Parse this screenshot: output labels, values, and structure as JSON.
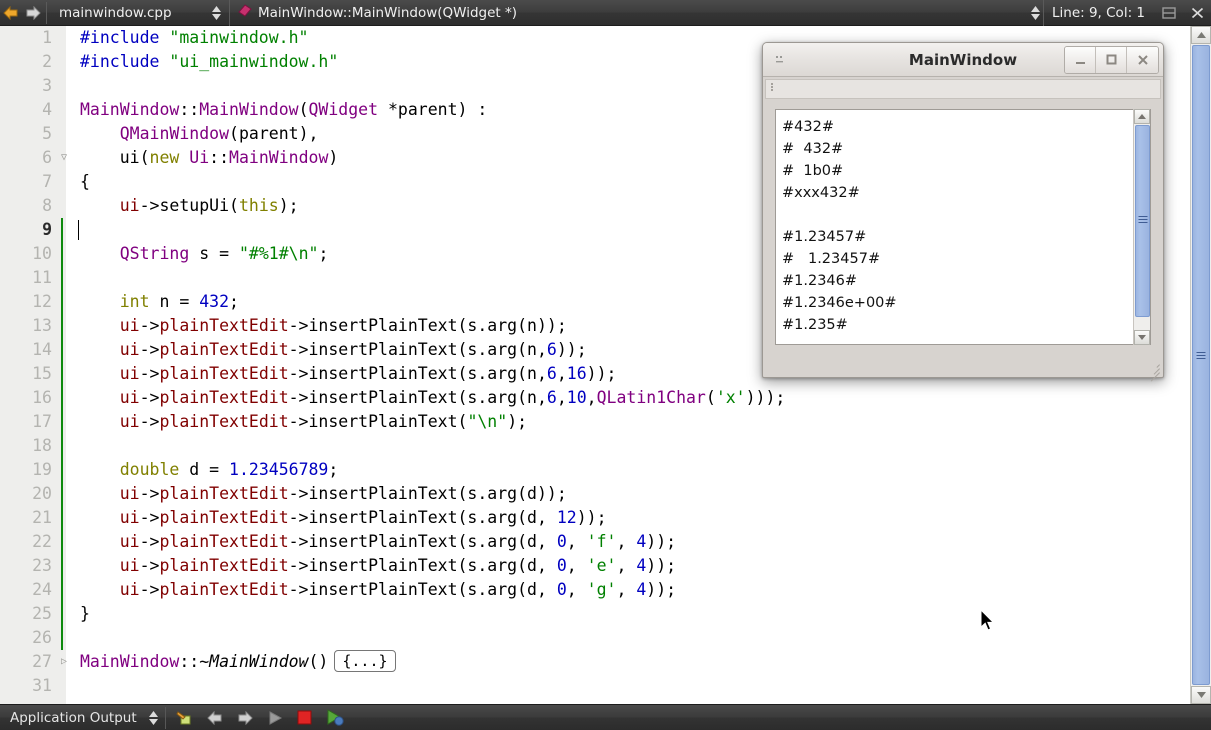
{
  "toolbar": {
    "back_icon": "back-arrow-icon",
    "forward_icon": "forward-arrow-icon",
    "file_name": "mainwindow.cpp",
    "symbol_name": "MainWindow::MainWindow(QWidget *)",
    "symbol_icon": "class-symbol-icon",
    "line_col": "Line: 9, Col: 1",
    "split_icon": "split-editor-icon",
    "close_icon": "close-editor-icon",
    "accent": "#e8a33d"
  },
  "editor": {
    "current_line": 9,
    "lines": [
      {
        "num": "1",
        "fold": "",
        "tokens": [
          {
            "t": "#include ",
            "c": "t-pre"
          },
          {
            "t": "\"mainwindow.h\"",
            "c": "t-str"
          }
        ]
      },
      {
        "num": "2",
        "fold": "",
        "tokens": [
          {
            "t": "#include ",
            "c": "t-pre"
          },
          {
            "t": "\"ui_mainwindow.h\"",
            "c": "t-str"
          }
        ]
      },
      {
        "num": "3",
        "fold": "",
        "tokens": []
      },
      {
        "num": "4",
        "fold": "",
        "tokens": [
          {
            "t": "MainWindow",
            "c": "t-type"
          },
          {
            "t": "::",
            "c": "t-op"
          },
          {
            "t": "MainWindow",
            "c": "t-type"
          },
          {
            "t": "(",
            "c": "t-op"
          },
          {
            "t": "QWidget",
            "c": "t-type"
          },
          {
            "t": " *parent) :",
            "c": "t-op"
          }
        ]
      },
      {
        "num": "5",
        "fold": "",
        "tokens": [
          {
            "t": "    ",
            "c": "t-op"
          },
          {
            "t": "QMainWindow",
            "c": "t-type"
          },
          {
            "t": "(parent),",
            "c": "t-op"
          }
        ]
      },
      {
        "num": "6",
        "fold": "▽",
        "tokens": [
          {
            "t": "    ui(",
            "c": "t-op"
          },
          {
            "t": "new",
            "c": "t-kw"
          },
          {
            "t": " ",
            "c": "t-op"
          },
          {
            "t": "Ui",
            "c": "t-type"
          },
          {
            "t": "::",
            "c": "t-op"
          },
          {
            "t": "MainWindow",
            "c": "t-type"
          },
          {
            "t": ")",
            "c": "t-op"
          }
        ]
      },
      {
        "num": "7",
        "fold": "",
        "tokens": [
          {
            "t": "{",
            "c": "t-op"
          }
        ]
      },
      {
        "num": "8",
        "fold": "",
        "tokens": [
          {
            "t": "    ui",
            "c": "t-mem"
          },
          {
            "t": "->setupUi(",
            "c": "t-fn"
          },
          {
            "t": "this",
            "c": "t-kw"
          },
          {
            "t": ");",
            "c": "t-fn"
          }
        ]
      },
      {
        "num": "9",
        "fold": "",
        "tokens": []
      },
      {
        "num": "10",
        "fold": "",
        "tokens": [
          {
            "t": "    ",
            "c": "t-op"
          },
          {
            "t": "QString",
            "c": "t-type"
          },
          {
            "t": " s = ",
            "c": "t-op"
          },
          {
            "t": "\"#%1#\\n\"",
            "c": "t-str"
          },
          {
            "t": ";",
            "c": "t-op"
          }
        ]
      },
      {
        "num": "11",
        "fold": "",
        "tokens": []
      },
      {
        "num": "12",
        "fold": "",
        "tokens": [
          {
            "t": "    ",
            "c": "t-op"
          },
          {
            "t": "int",
            "c": "t-kw"
          },
          {
            "t": " n = ",
            "c": "t-op"
          },
          {
            "t": "432",
            "c": "t-num"
          },
          {
            "t": ";",
            "c": "t-op"
          }
        ]
      },
      {
        "num": "13",
        "fold": "",
        "tokens": [
          {
            "t": "    ui",
            "c": "t-mem"
          },
          {
            "t": "->",
            "c": "t-fn"
          },
          {
            "t": "plainTextEdit",
            "c": "t-mem"
          },
          {
            "t": "->insertPlainText(s.arg(n));",
            "c": "t-fn"
          }
        ]
      },
      {
        "num": "14",
        "fold": "",
        "tokens": [
          {
            "t": "    ui",
            "c": "t-mem"
          },
          {
            "t": "->",
            "c": "t-fn"
          },
          {
            "t": "plainTextEdit",
            "c": "t-mem"
          },
          {
            "t": "->insertPlainText(s.arg(n,",
            "c": "t-fn"
          },
          {
            "t": "6",
            "c": "t-num"
          },
          {
            "t": "));",
            "c": "t-fn"
          }
        ]
      },
      {
        "num": "15",
        "fold": "",
        "tokens": [
          {
            "t": "    ui",
            "c": "t-mem"
          },
          {
            "t": "->",
            "c": "t-fn"
          },
          {
            "t": "plainTextEdit",
            "c": "t-mem"
          },
          {
            "t": "->insertPlainText(s.arg(n,",
            "c": "t-fn"
          },
          {
            "t": "6",
            "c": "t-num"
          },
          {
            "t": ",",
            "c": "t-fn"
          },
          {
            "t": "16",
            "c": "t-num"
          },
          {
            "t": "));",
            "c": "t-fn"
          }
        ]
      },
      {
        "num": "16",
        "fold": "",
        "tokens": [
          {
            "t": "    ui",
            "c": "t-mem"
          },
          {
            "t": "->",
            "c": "t-fn"
          },
          {
            "t": "plainTextEdit",
            "c": "t-mem"
          },
          {
            "t": "->insertPlainText(s.arg(n,",
            "c": "t-fn"
          },
          {
            "t": "6",
            "c": "t-num"
          },
          {
            "t": ",",
            "c": "t-fn"
          },
          {
            "t": "10",
            "c": "t-num"
          },
          {
            "t": ",",
            "c": "t-fn"
          },
          {
            "t": "QLatin1Char",
            "c": "t-type"
          },
          {
            "t": "(",
            "c": "t-fn"
          },
          {
            "t": "'x'",
            "c": "t-str"
          },
          {
            "t": ")));",
            "c": "t-fn"
          }
        ]
      },
      {
        "num": "17",
        "fold": "",
        "tokens": [
          {
            "t": "    ui",
            "c": "t-mem"
          },
          {
            "t": "->",
            "c": "t-fn"
          },
          {
            "t": "plainTextEdit",
            "c": "t-mem"
          },
          {
            "t": "->insertPlainText(",
            "c": "t-fn"
          },
          {
            "t": "\"\\n\"",
            "c": "t-str"
          },
          {
            "t": ");",
            "c": "t-fn"
          }
        ]
      },
      {
        "num": "18",
        "fold": "",
        "tokens": []
      },
      {
        "num": "19",
        "fold": "",
        "tokens": [
          {
            "t": "    ",
            "c": "t-op"
          },
          {
            "t": "double",
            "c": "t-kw"
          },
          {
            "t": " d = ",
            "c": "t-op"
          },
          {
            "t": "1.23456789",
            "c": "t-num"
          },
          {
            "t": ";",
            "c": "t-op"
          }
        ]
      },
      {
        "num": "20",
        "fold": "",
        "tokens": [
          {
            "t": "    ui",
            "c": "t-mem"
          },
          {
            "t": "->",
            "c": "t-fn"
          },
          {
            "t": "plainTextEdit",
            "c": "t-mem"
          },
          {
            "t": "->insertPlainText(s.arg(d));",
            "c": "t-fn"
          }
        ]
      },
      {
        "num": "21",
        "fold": "",
        "tokens": [
          {
            "t": "    ui",
            "c": "t-mem"
          },
          {
            "t": "->",
            "c": "t-fn"
          },
          {
            "t": "plainTextEdit",
            "c": "t-mem"
          },
          {
            "t": "->insertPlainText(s.arg(d, ",
            "c": "t-fn"
          },
          {
            "t": "12",
            "c": "t-num"
          },
          {
            "t": "));",
            "c": "t-fn"
          }
        ]
      },
      {
        "num": "22",
        "fold": "",
        "tokens": [
          {
            "t": "    ui",
            "c": "t-mem"
          },
          {
            "t": "->",
            "c": "t-fn"
          },
          {
            "t": "plainTextEdit",
            "c": "t-mem"
          },
          {
            "t": "->insertPlainText(s.arg(d, ",
            "c": "t-fn"
          },
          {
            "t": "0",
            "c": "t-num"
          },
          {
            "t": ", ",
            "c": "t-fn"
          },
          {
            "t": "'f'",
            "c": "t-str"
          },
          {
            "t": ", ",
            "c": "t-fn"
          },
          {
            "t": "4",
            "c": "t-num"
          },
          {
            "t": "));",
            "c": "t-fn"
          }
        ]
      },
      {
        "num": "23",
        "fold": "",
        "tokens": [
          {
            "t": "    ui",
            "c": "t-mem"
          },
          {
            "t": "->",
            "c": "t-fn"
          },
          {
            "t": "plainTextEdit",
            "c": "t-mem"
          },
          {
            "t": "->insertPlainText(s.arg(d, ",
            "c": "t-fn"
          },
          {
            "t": "0",
            "c": "t-num"
          },
          {
            "t": ", ",
            "c": "t-fn"
          },
          {
            "t": "'e'",
            "c": "t-str"
          },
          {
            "t": ", ",
            "c": "t-fn"
          },
          {
            "t": "4",
            "c": "t-num"
          },
          {
            "t": "));",
            "c": "t-fn"
          }
        ]
      },
      {
        "num": "24",
        "fold": "",
        "tokens": [
          {
            "t": "    ui",
            "c": "t-mem"
          },
          {
            "t": "->",
            "c": "t-fn"
          },
          {
            "t": "plainTextEdit",
            "c": "t-mem"
          },
          {
            "t": "->insertPlainText(s.arg(d, ",
            "c": "t-fn"
          },
          {
            "t": "0",
            "c": "t-num"
          },
          {
            "t": ", ",
            "c": "t-fn"
          },
          {
            "t": "'g'",
            "c": "t-str"
          },
          {
            "t": ", ",
            "c": "t-fn"
          },
          {
            "t": "4",
            "c": "t-num"
          },
          {
            "t": "));",
            "c": "t-fn"
          }
        ]
      },
      {
        "num": "25",
        "fold": "",
        "tokens": [
          {
            "t": "}",
            "c": "t-op"
          }
        ]
      },
      {
        "num": "26",
        "fold": "",
        "tokens": []
      },
      {
        "num": "27",
        "fold": "▷",
        "tokens": [
          {
            "t": "MainWindow",
            "c": "t-type"
          },
          {
            "t": "::",
            "c": "t-op"
          },
          {
            "t": "~MainWindow",
            "c": "t-it"
          },
          {
            "t": "()",
            "c": "t-op"
          }
        ],
        "foldbox": "{...}"
      },
      {
        "num": "31",
        "fold": "",
        "tokens": []
      }
    ]
  },
  "dialog": {
    "title": "MainWindow",
    "sysmenu_icon": "system-menu-icon",
    "minimize_label": "_",
    "maximize_label": "□",
    "close_label": "✕",
    "output_text": "#432#\n#  432#\n#  1b0#\n#xxx432#\n\n#1.23457#\n#   1.23457#\n#1.2346#\n#1.2346e+00#\n#1.235#",
    "scroll_up_icon": "scroll-up-icon",
    "scroll_down_icon": "scroll-down-icon"
  },
  "bottombar": {
    "pane_label": "Application Output",
    "icons": [
      {
        "name": "clear-output-icon"
      },
      {
        "name": "previous-item-icon"
      },
      {
        "name": "next-item-icon"
      },
      {
        "name": "run-icon"
      },
      {
        "name": "stop-icon"
      },
      {
        "name": "rerun-icon"
      }
    ]
  },
  "scrollbar": {
    "up_icon": "scroll-up-icon",
    "down_icon": "scroll-down-icon"
  }
}
